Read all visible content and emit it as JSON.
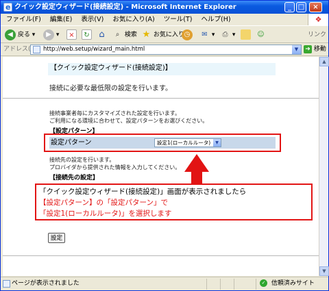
{
  "window": {
    "title": "クイック設定ウィザード(接続設定) - Microsoft Internet Explorer",
    "buttons": {
      "min": "_",
      "max": "□",
      "close": "×"
    }
  },
  "menu": [
    "ファイル(F)",
    "編集(E)",
    "表示(V)",
    "お気に入り(A)",
    "ツール(T)",
    "ヘルプ(H)"
  ],
  "toolbar": {
    "back": "戻る",
    "search": "検索",
    "favorites": "お気に入り",
    "links": "リンク",
    "icons": [
      "back-icon",
      "forward-icon",
      "stop-icon",
      "refresh-icon",
      "home-icon",
      "search-icon",
      "favorites-icon",
      "history-icon",
      "mail-icon",
      "print-icon",
      "folder-icon",
      "messenger-icon"
    ]
  },
  "address": {
    "label": "アドレス(D)",
    "url": "http://web.setup/wizard_main.html",
    "go": "移動"
  },
  "page": {
    "header": "【クイック設定ウィザード(接続設定)】",
    "subtitle": "接続に必要な最低限の設定を行います。",
    "intro_line1": "接続事業者毎にカスタマイズされた設定を行います。",
    "intro_line2": "ご利用になる環境に合わせて、設定パターンをお選びください。",
    "section1": "【設定パターン】",
    "pattern_label": "設定パターン",
    "pattern_value": "設定1(ローカルルータ)",
    "conn_line1": "接続先の設定を行います。",
    "conn_line2": "プロバイダから提供された情報を入力してください。",
    "section2": "【接続先の設定】",
    "submit": "設定"
  },
  "callout": {
    "line1": "「クイック設定ウィザード(接続設定)」画面が表示されましたら",
    "line2": "【設定パターン】の「設定パターン」で",
    "line3": "「設定1(ローカルルータ)」を選択します"
  },
  "status": {
    "text": "ページが表示されました",
    "zone": "信頼済みサイト"
  },
  "colors": {
    "accent_red": "#e21414",
    "header_bg": "#e9f6fc",
    "row_bg": "#c8d8ea"
  }
}
